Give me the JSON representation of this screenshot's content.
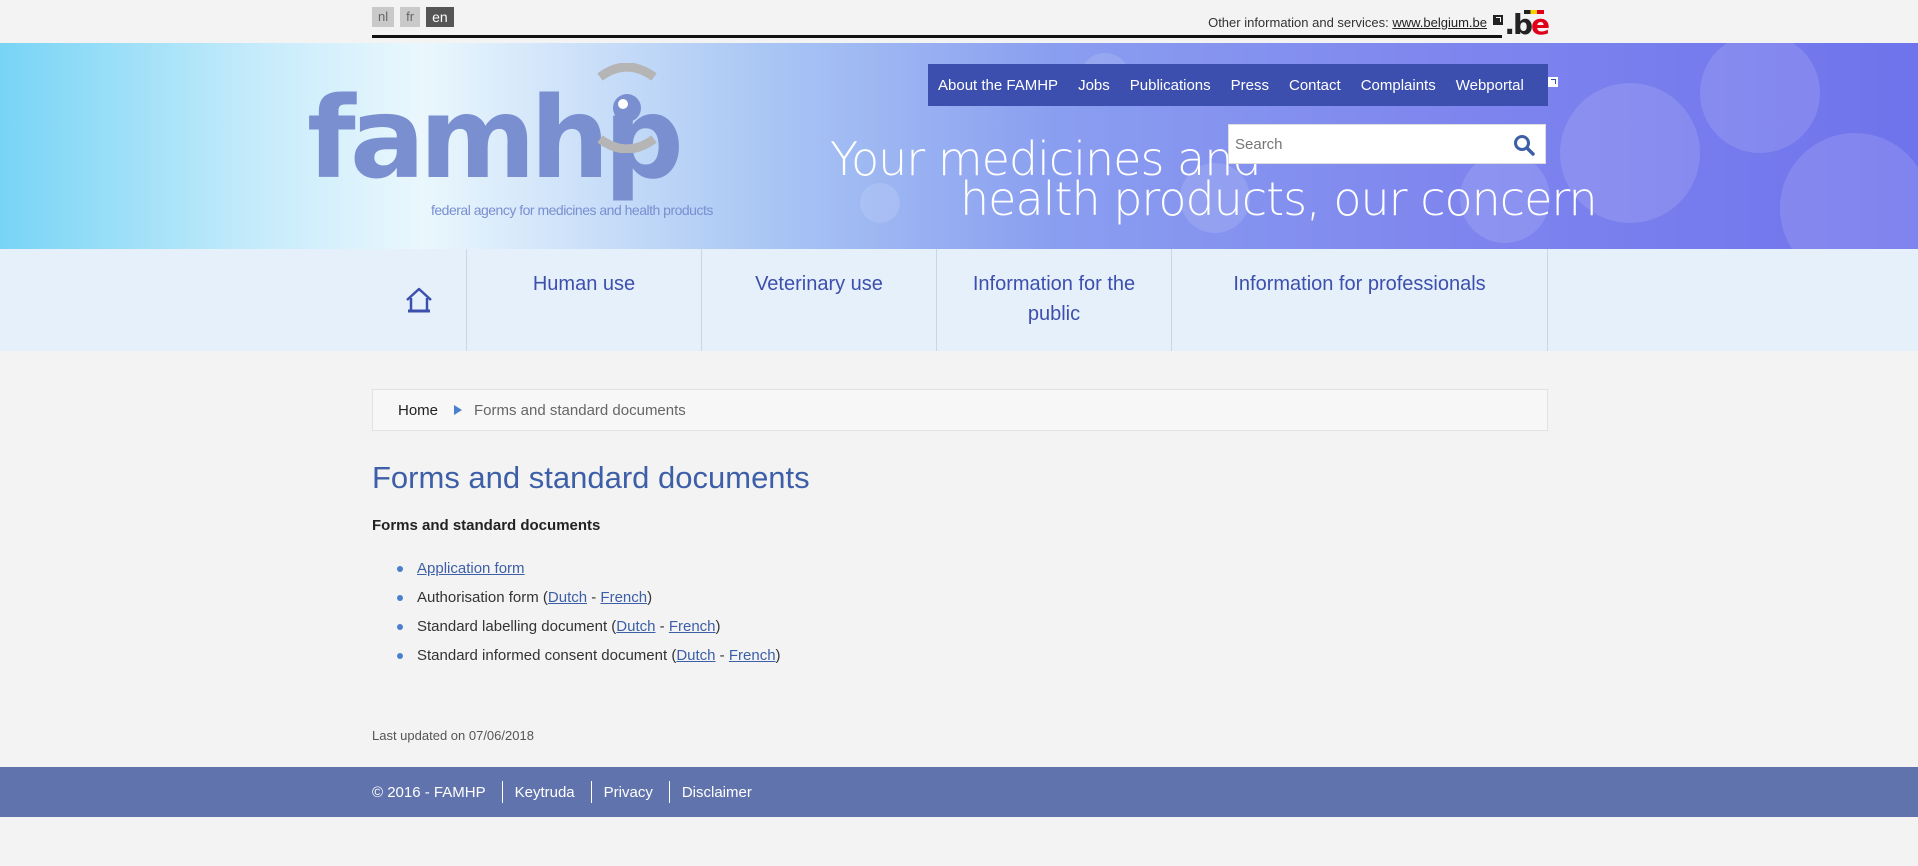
{
  "languages": [
    {
      "label": "nl",
      "active": false
    },
    {
      "label": "fr",
      "active": false
    },
    {
      "label": "en",
      "active": true
    }
  ],
  "topbar": {
    "other_info_label": "Other information and services:",
    "other_info_link": "www.belgium.be",
    "be_logo": ".be"
  },
  "banner": {
    "logo_word": "famhp",
    "logo_subtitle": "federal agency for medicines and health products",
    "tagline_line1": "Your medicines and",
    "tagline_line2": "health products, our concern"
  },
  "topnav": {
    "items": [
      "About the FAMHP",
      "Jobs",
      "Publications",
      "Press",
      "Contact",
      "Complaints",
      "Webportal"
    ]
  },
  "search": {
    "placeholder": "Search"
  },
  "mainnav": {
    "home_icon": "home-icon",
    "items": [
      "Human use",
      "Veterinary use",
      "Information for the public",
      "Information for professionals"
    ]
  },
  "breadcrumb": {
    "home": "Home",
    "current": "Forms and standard documents"
  },
  "page": {
    "title": "Forms and standard documents",
    "subheading": "Forms and standard documents",
    "items": [
      {
        "link": "Application form"
      },
      {
        "text": "Authorisation form (",
        "link1": "Dutch",
        "dash": " - ",
        "link2": "French",
        "close": ")"
      },
      {
        "text": "Standard labelling document (",
        "link1": "Dutch",
        "dash": " - ",
        "link2": "French",
        "close": ")"
      },
      {
        "text": "Standard informed consent document (",
        "link1": "Dutch",
        "dash": " - ",
        "link2": "French",
        "close": ")"
      }
    ],
    "last_updated": "Last updated on 07/06/2018"
  },
  "footer": {
    "copyright": "© 2016 - FAMHP",
    "links": [
      "Keytruda",
      "Privacy",
      "Disclaimer"
    ]
  },
  "colors": {
    "nav_bg": "#3d4fae",
    "title": "#3d5fa8",
    "footer_bg": "#6073ad",
    "mainnav_bg": "#e6f0fa"
  }
}
